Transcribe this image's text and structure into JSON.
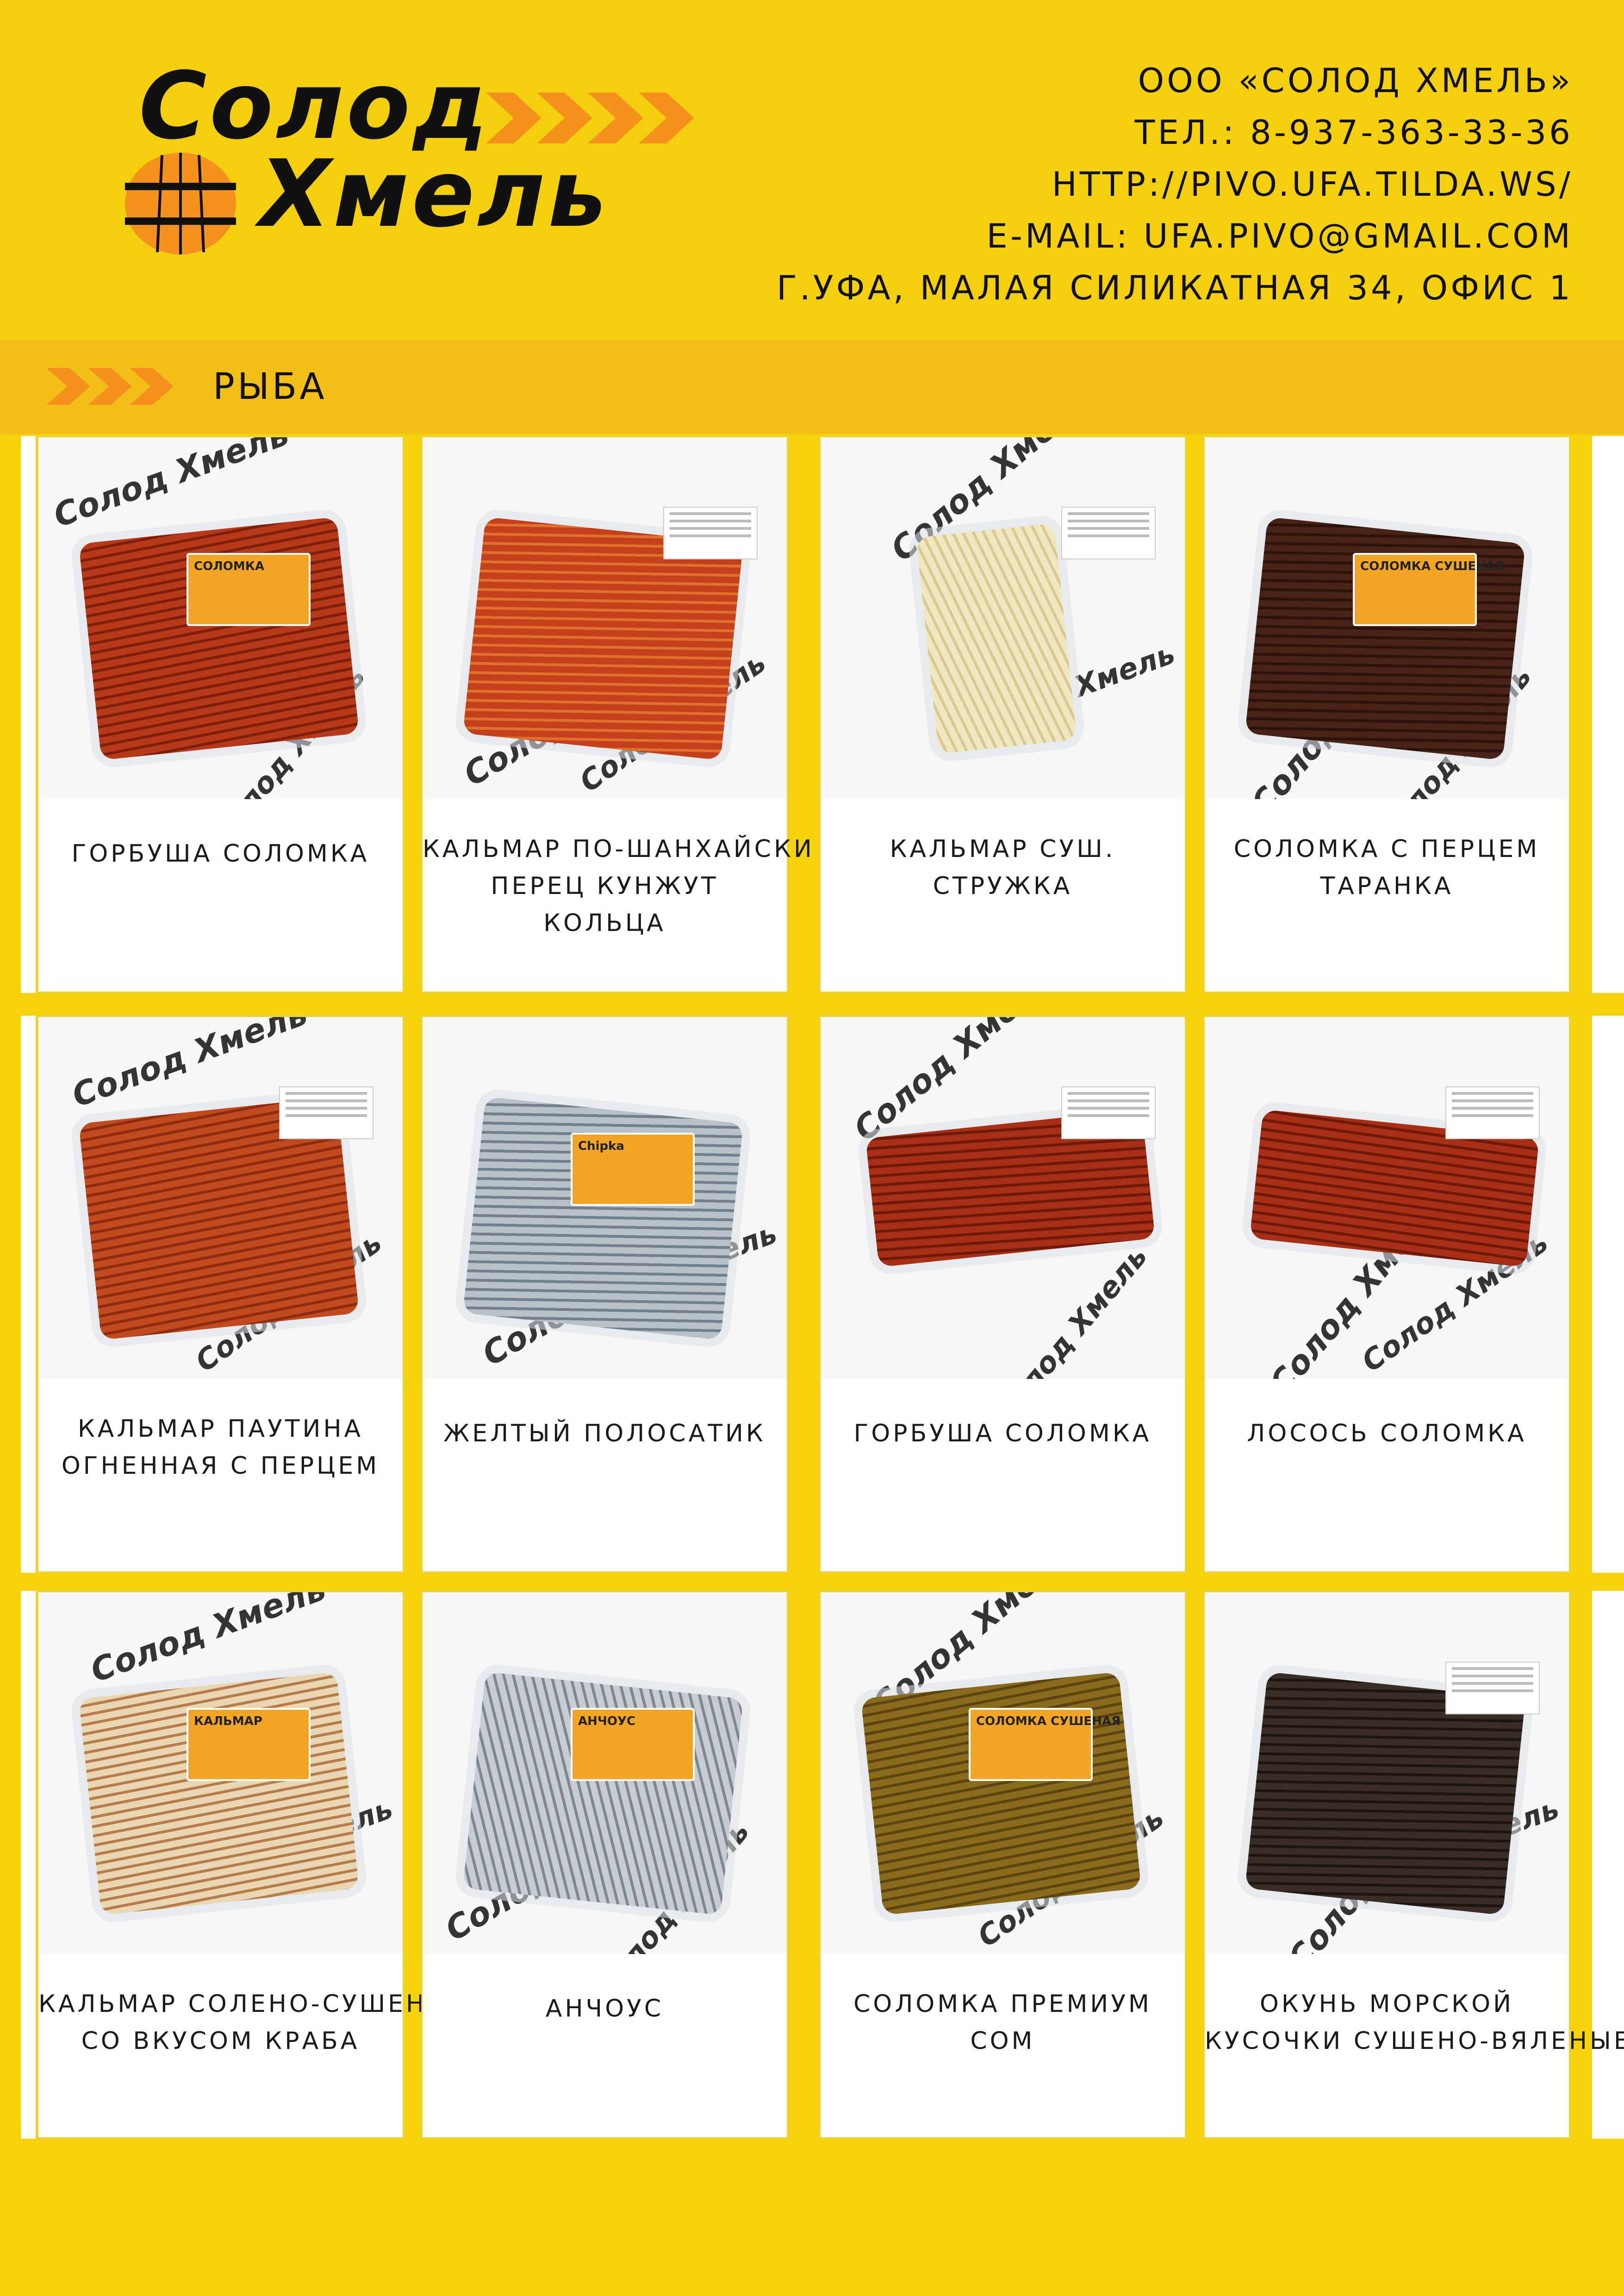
{
  "brand": {
    "logo_line1": "Солод",
    "logo_line2": "Хмель",
    "accent_color": "#f5921e",
    "text_color": "#111111"
  },
  "contacts": {
    "company": "ООО «СОЛОД ХМЕЛЬ»",
    "phone": "ТЕЛ.: 8-937-363-33-36",
    "website": "HTTP://PIVO.UFA.TILDA.WS/",
    "email": "E-MAIL: UFA.PIVO@GMAIL.COM",
    "address": "Г.УФА, МАЛАЯ СИЛИКАТНАЯ 34, ОФИС 1"
  },
  "section": {
    "title": "РЫБА",
    "icon": "chevron-arrows-icon"
  },
  "products": [
    {
      "lines": [
        "ГОРБУША   СОЛОМКА"
      ],
      "kind": "sticks-red",
      "tag": "СОЛОМКА"
    },
    {
      "lines": [
        "КАЛЬМАР ПО-ШАНХАЙСКИ",
        "ПЕРЕЦ КУНЖУТ",
        "КОЛЬЦА"
      ],
      "kind": "mass-red",
      "tag": ""
    },
    {
      "lines": [
        "КАЛЬМАР СУШ.",
        "СТРУЖКА"
      ],
      "kind": "shavings",
      "tag": ""
    },
    {
      "lines": [
        "СОЛОМКА С ПЕРЦЕМ",
        "ТАРАНКА"
      ],
      "kind": "sticks-dark",
      "tag": "СОЛОМКА СУШЕНАЯ"
    },
    {
      "lines": [
        "КАЛЬМАР ПАУТИНА",
        "ОГНЕННАЯ  С  ПЕРЦЕМ"
      ],
      "kind": "web-red",
      "tag": ""
    },
    {
      "lines": [
        "ЖЕЛТЫЙ ПОЛОСАТИК"
      ],
      "kind": "fish-silver",
      "tag": "Chipka"
    },
    {
      "lines": [
        "ГОРБУША СОЛОМКА"
      ],
      "kind": "sticks-red-flat",
      "tag": ""
    },
    {
      "lines": [
        "ЛОСОСЬ СОЛОМКА"
      ],
      "kind": "sticks-red-flat",
      "tag": ""
    },
    {
      "lines": [
        "КАЛЬМАР СОЛЕНО-СУШЕНЫЙ",
        "СО   ВКУСОМ   КРАБА"
      ],
      "kind": "squid-pale",
      "tag": "КАЛЬМАР"
    },
    {
      "lines": [
        "АНЧОУС"
      ],
      "kind": "anchovy",
      "tag": "АНЧОУС"
    },
    {
      "lines": [
        "СОЛОМКА  ПРЕМИУМ",
        "СОМ"
      ],
      "kind": "sticks-olive",
      "tag": "СОЛОМКА СУШЕНАЯ"
    },
    {
      "lines": [
        "ОКУНЬ  МОРСКОЙ",
        "КУСОЧКИ СУШЕНО-ВЯЛЕНЫЕ"
      ],
      "kind": "pieces-dark",
      "tag": ""
    }
  ]
}
